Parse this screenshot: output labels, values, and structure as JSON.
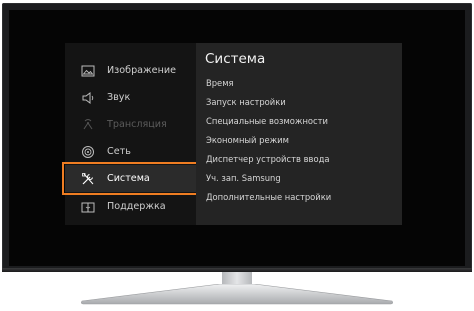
{
  "menu": {
    "items": [
      {
        "label": "Изображение",
        "icon": "picture-icon",
        "state": "normal"
      },
      {
        "label": "Звук",
        "icon": "speaker-icon",
        "state": "normal"
      },
      {
        "label": "Трансляция",
        "icon": "broadcast-icon",
        "state": "disabled"
      },
      {
        "label": "Сеть",
        "icon": "network-icon",
        "state": "normal"
      },
      {
        "label": "Система",
        "icon": "tools-icon",
        "state": "selected"
      },
      {
        "label": "Поддержка",
        "icon": "support-icon",
        "state": "normal"
      }
    ]
  },
  "submenu": {
    "title": "Система",
    "items": [
      "Время",
      "Запуск настройки",
      "Специальные возможности",
      "Экономный режим",
      "Диспетчер устройств ввода",
      "Уч. зап. Samsung",
      "Дополнительные настройки"
    ]
  },
  "colors": {
    "accent": "#ef7d22",
    "tv_frame": "#1b1c1e",
    "screen": "#050505",
    "menu_bg": "#141414",
    "submenu_bg": "#242424"
  }
}
